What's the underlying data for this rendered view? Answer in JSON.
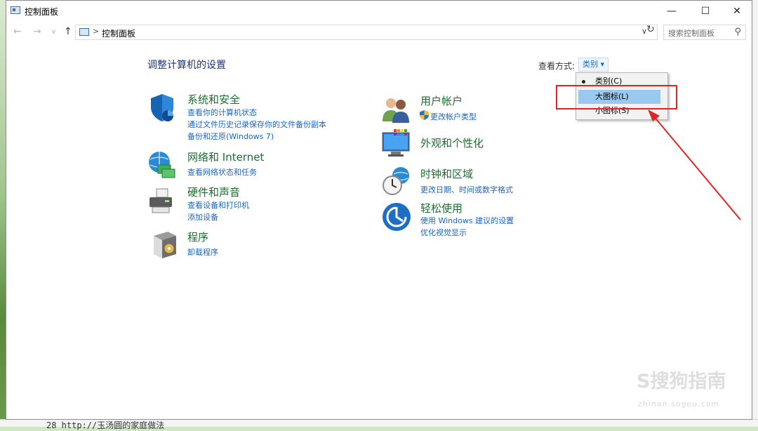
{
  "window": {
    "title": "控制面板",
    "minimize_glyph": "—",
    "maximize_glyph": "☐",
    "close_glyph": "✕"
  },
  "nav": {
    "back_glyph": "←",
    "forward_glyph": "→",
    "recent_glyph": "∨",
    "up_glyph": "↑",
    "breadcrumb_sep": ">",
    "breadcrumb": "控制面板",
    "dropdown_glyph": "∨",
    "refresh_glyph": "↻",
    "search_placeholder": "搜索控制面板",
    "search_glyph": "⚲"
  },
  "main": {
    "title": "调整计算机的设置",
    "view_label": "查看方式:",
    "view_value": "类别 ▾"
  },
  "categories_left": [
    {
      "title": "系统和安全",
      "links": [
        "查看你的计算机状态",
        "通过文件历史记录保存你的文件备份副本",
        "备份和还原(Windows 7)"
      ]
    },
    {
      "title": "网络和 Internet",
      "links": [
        "查看网络状态和任务"
      ]
    },
    {
      "title": "硬件和声音",
      "links": [
        "查看设备和打印机",
        "添加设备"
      ]
    },
    {
      "title": "程序",
      "links": [
        "卸载程序"
      ]
    }
  ],
  "categories_right": [
    {
      "title": "用户帐户",
      "links": [
        "更改帐户类型"
      ]
    },
    {
      "title": "外观和个性化",
      "links": []
    },
    {
      "title": "时钟和区域",
      "links": [
        "更改日期、时间或数字格式"
      ]
    },
    {
      "title": "轻松使用",
      "links": [
        "使用 Windows 建议的设置",
        "优化视觉显示"
      ]
    }
  ],
  "menu": {
    "items": [
      "类别(C)",
      "大图标(L)",
      "小图标(S)"
    ]
  },
  "background": {
    "bottom_text": "28  http://玉汤圆的家庭做法"
  },
  "watermark": {
    "text": "S搜狗指南",
    "sub": "zhinan.sogou.com"
  },
  "colors": {
    "category_title": "#1a6d2e",
    "link": "#1a64c7",
    "heading": "#1e3287",
    "highlight": "#99c9ef",
    "annotation": "#e02424"
  }
}
